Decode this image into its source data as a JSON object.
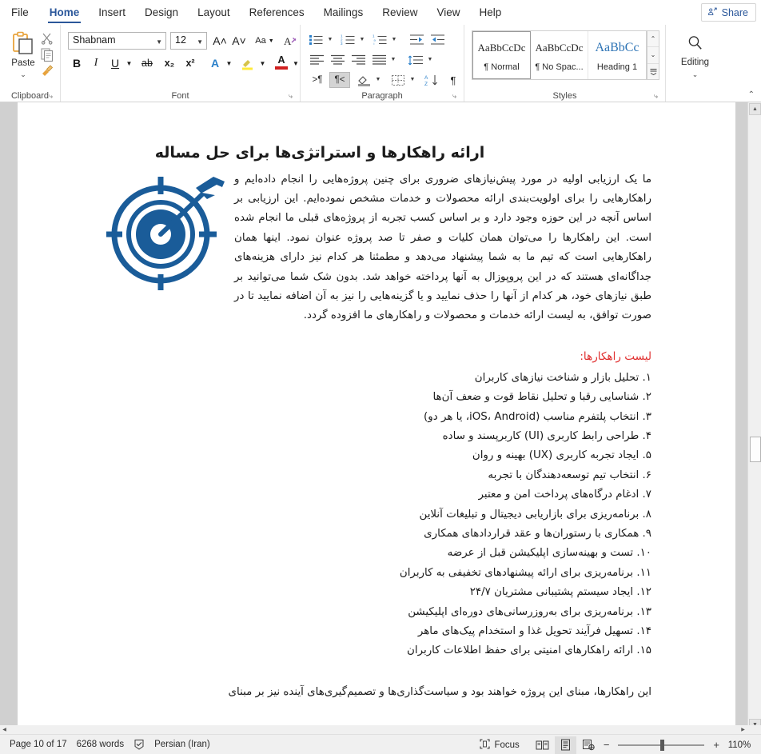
{
  "window": {
    "accent_color": "#2b579a",
    "share_label": "Share",
    "share_icon": "share-person-icon"
  },
  "tabs": [
    {
      "label": "File",
      "active": false
    },
    {
      "label": "Home",
      "active": true
    },
    {
      "label": "Insert",
      "active": false
    },
    {
      "label": "Design",
      "active": false
    },
    {
      "label": "Layout",
      "active": false
    },
    {
      "label": "References",
      "active": false
    },
    {
      "label": "Mailings",
      "active": false
    },
    {
      "label": "Review",
      "active": false
    },
    {
      "label": "View",
      "active": false
    },
    {
      "label": "Help",
      "active": false
    }
  ],
  "ribbon": {
    "clipboard": {
      "group_label": "Clipboard",
      "paste_label": "Paste",
      "paste_caret": "⌄",
      "cut_icon": "scissors-icon",
      "copy_icon": "copy-icon",
      "format_painter_icon": "format-painter-icon",
      "dialog_launcher": "⤷"
    },
    "font": {
      "group_label": "Font",
      "font_name": "Shabnam",
      "font_size": "12",
      "grow_font": "A˄",
      "shrink_font": "A˅",
      "change_case": "Aa",
      "clear_formatting_icon": "clear-formatting-icon",
      "bold": "B",
      "italic": "I",
      "underline": "U",
      "strikethrough": "ab",
      "subscript": "x₂",
      "superscript": "x²",
      "text_effects": "A",
      "highlight_icon": "highlight-pen-icon",
      "font_color": "A",
      "dialog_launcher": "⤷"
    },
    "paragraph": {
      "group_label": "Paragraph",
      "bullets_icon": "bullet-list-icon",
      "numbering_icon": "numbered-list-icon",
      "multilevel_icon": "multilevel-list-icon",
      "decrease_indent_icon": "decrease-indent-icon",
      "increase_indent_icon": "increase-indent-icon",
      "align_left_icon": "align-left-icon",
      "align_center_icon": "align-center-icon",
      "align_right_icon": "align-right-icon",
      "justify_icon": "justify-icon",
      "line_spacing_icon": "line-spacing-icon",
      "ltr_label": ">¶",
      "rtl_label": "¶<",
      "rtl_active": true,
      "shading_icon": "shading-icon",
      "borders_icon": "borders-icon",
      "sort_icon": "sort-az-icon",
      "show_marks": "¶",
      "dialog_launcher": "⤷"
    },
    "styles": {
      "group_label": "Styles",
      "items": [
        {
          "preview": "AaBbCcDc",
          "name": "¶ Normal",
          "selected": true
        },
        {
          "preview": "AaBbCcDc",
          "name": "¶ No Spac...",
          "selected": false
        },
        {
          "preview": "AaBbCс",
          "name": "Heading 1",
          "selected": false
        }
      ],
      "scroll_up": "⌃",
      "scroll_down": "⌄",
      "more": "☰",
      "dialog_launcher": "⤷"
    },
    "editing": {
      "group_label": "Editing",
      "label": "Editing",
      "icon": "magnifier-icon",
      "caret": "⌄"
    },
    "collapse_icon": "⌃"
  },
  "document": {
    "title": "ارائه راهکارها و استراتژی‌ها برای حل مساله",
    "graphic_icon": "target-dart-icon",
    "graphic_color": "#1a5c99",
    "body_paragraph": "ما یک ارزیابی اولیه در مورد پیش‌نیازهای ضروری برای چنین پروژه‌هایی را انجام داده‌ایم و راهکارهایی را برای اولویت‌بندی ارائه محصولات و خدمات مشخص نموده‌ایم. این ارزیابی بر اساس آنچه در این حوزه وجود دارد و بر اساس کسب تجربه از پروژه‌های قبلی ما انجام شده است. این راهکارها را می‌توان همان کلیات و صفر تا صد پروژه عنوان نمود. اینها همان راهکارهایی است که تیم ما به شما پیشنهاد می‌دهد و مطمئنا هر کدام نیز دارای هزینه‌های جداگانه‌ای هستند که در این پروپوزال به آنها پرداخته خواهد شد. بدون شک شما می‌توانید بر طبق نیازهای خود، هر کدام از آنها را حذف نمایید و یا گزینه‌هایی را نیز به آن اضافه نمایید تا در صورت توافق، به لیست ارائه خدمات و محصولات و راهکارهای ما افزوده گردد.",
    "list_heading": "لیست راهکارها:",
    "list_heading_color": "#e03030",
    "list_items": [
      "۱. تحلیل بازار و شناخت نیازهای کاربران",
      "۲. شناسایی رقبا و تحلیل نقاط قوت و ضعف آن‌ها",
      "۳. انتخاب پلتفرم مناسب (iOS، Android، یا هر دو)",
      "۴. طراحی رابط کاربری (UI) کاربرپسند و ساده",
      "۵. ایجاد تجربه کاربری (UX) بهینه و روان",
      "۶. انتخاب تیم توسعه‌دهندگان با تجربه",
      "۷. ادغام درگاه‌های پرداخت امن و معتبر",
      "۸. برنامه‌ریزی برای بازاریابی دیجیتال و تبلیغات آنلاین",
      "۹. همکاری با رستوران‌ها و عقد قراردادهای همکاری",
      "۱۰. تست و بهینه‌سازی اپلیکیشن قبل از عرضه",
      "۱۱. برنامه‌ریزی برای ارائه پیشنهادهای تخفیفی به کاربران",
      "۱۲. ایجاد سیستم پشتیبانی مشتریان ۲۴/۷",
      "۱۳. برنامه‌ریزی برای به‌روزرسانی‌های دوره‌ای اپلیکیشن",
      "۱۴. تسهیل فرآیند تحویل غذا و استخدام پیک‌های ماهر",
      "۱۵. ارائه راهکارهای امنیتی برای حفظ اطلاعات کاربران"
    ],
    "tail_paragraph": "این راهکارها، مبنای این پروژه خواهند بود و سیاست‌گذاری‌ها و تصمیم‌گیری‌های آینده نیز بر مبنای"
  },
  "statusbar": {
    "page": "Page 10 of 17",
    "words": "6268 words",
    "proofing_icon": "proofing-check-icon",
    "language": "Persian (Iran)",
    "focus_label": "Focus",
    "focus_icon": "focus-icon",
    "view_read_icon": "read-mode-icon",
    "view_print_icon": "print-layout-icon",
    "view_web_icon": "web-layout-icon",
    "active_view": "print-layout-icon",
    "zoom_out": "−",
    "zoom_in": "+",
    "zoom_level": "110%"
  }
}
